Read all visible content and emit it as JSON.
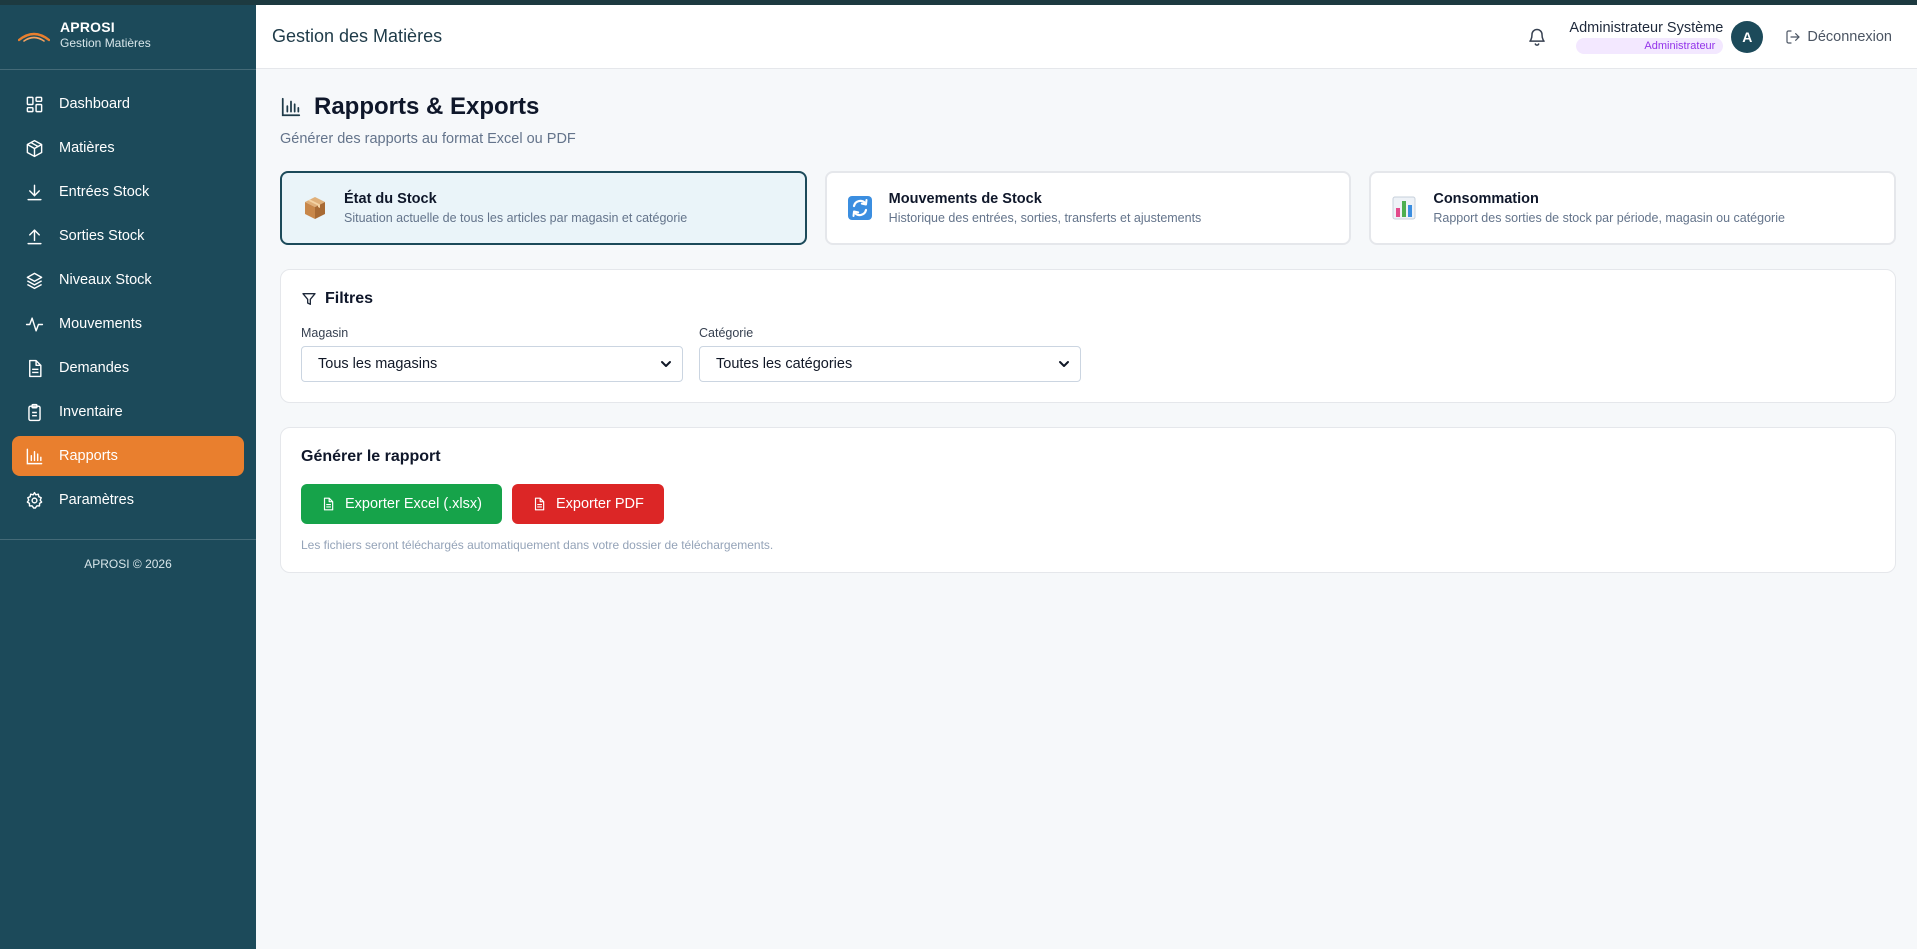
{
  "sidebar": {
    "brand_name": "APROSI",
    "brand_subtitle": "Gestion Matières",
    "items": [
      {
        "label": "Dashboard",
        "icon": "dashboard-icon"
      },
      {
        "label": "Matières",
        "icon": "box-icon"
      },
      {
        "label": "Entrées Stock",
        "icon": "arrow-down-icon"
      },
      {
        "label": "Sorties Stock",
        "icon": "arrow-up-icon"
      },
      {
        "label": "Niveaux Stock",
        "icon": "layers-icon"
      },
      {
        "label": "Mouvements",
        "icon": "activity-icon"
      },
      {
        "label": "Demandes",
        "icon": "document-icon"
      },
      {
        "label": "Inventaire",
        "icon": "clipboard-icon"
      },
      {
        "label": "Rapports",
        "icon": "bar-chart-icon",
        "active": true
      },
      {
        "label": "Paramètres",
        "icon": "gear-icon"
      }
    ],
    "copyright": "APROSI © 2026"
  },
  "header": {
    "title": "Gestion des Matières",
    "user_name": "Administrateur Système",
    "user_role": "Administrateur",
    "avatar_initial": "A",
    "logout_label": "Déconnexion"
  },
  "page": {
    "title": "Rapports & Exports",
    "subtitle": "Générer des rapports au format Excel ou PDF"
  },
  "report_types": [
    {
      "title": "État du Stock",
      "description": "Situation actuelle de tous les articles par magasin et catégorie",
      "icon": "package-icon",
      "selected": true
    },
    {
      "title": "Mouvements de Stock",
      "description": "Historique des entrées, sorties, transferts et ajustements",
      "icon": "refresh-icon",
      "selected": false
    },
    {
      "title": "Consommation",
      "description": "Rapport des sorties de stock par période, magasin ou catégorie",
      "icon": "chart-icon",
      "selected": false
    }
  ],
  "filters": {
    "title": "Filtres",
    "magasin_label": "Magasin",
    "magasin_value": "Tous les magasins",
    "categorie_label": "Catégorie",
    "categorie_value": "Toutes les catégories"
  },
  "generate": {
    "title": "Générer le rapport",
    "excel_label": "Exporter Excel (.xlsx)",
    "pdf_label": "Exporter PDF",
    "hint": "Les fichiers seront téléchargés automatiquement dans votre dossier de téléchargements."
  },
  "colors": {
    "sidebar_bg": "#1c4a5a",
    "accent": "#e97f2e",
    "excel_green": "#16a34a",
    "pdf_red": "#dc2626",
    "role_purple": "#9333ea"
  }
}
